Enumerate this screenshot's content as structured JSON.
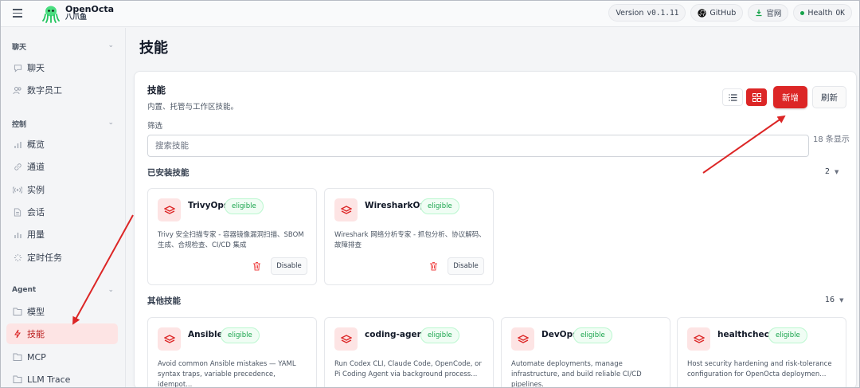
{
  "topbar": {
    "brand_name": "OpenOcta",
    "brand_sub": "八爪鱼",
    "version_label": "Version",
    "version_value": "v0.1.11",
    "github_label": "GitHub",
    "website_label": "官网",
    "health_label": "Health",
    "health_value": "OK"
  },
  "sidebar": {
    "sections": [
      {
        "title": "聊天",
        "items": [
          "聊天",
          "数字员工"
        ]
      },
      {
        "title": "控制",
        "items": [
          "概览",
          "通道",
          "实例",
          "会话",
          "用量",
          "定时任务"
        ]
      },
      {
        "title": "Agent",
        "items": [
          "模型",
          "技能",
          "MCP",
          "LLM Trace"
        ]
      }
    ]
  },
  "page": {
    "title": "技能"
  },
  "card": {
    "title": "技能",
    "subtitle": "内置、托管与工作区技能。",
    "filter_label": "筛选",
    "search_placeholder": "搜索技能",
    "count_text": "18 条显示",
    "add_label": "新增",
    "refresh_label": "刷新"
  },
  "installed": {
    "title": "已安装技能",
    "count": "2",
    "skills": [
      {
        "name": "TrivyOps",
        "badge": "eligible",
        "desc": "Trivy 安全扫描专家 - 容器镜像漏洞扫描、SBOM 生成、合规检查、CI/CD 集成",
        "disable_label": "Disable"
      },
      {
        "name": "WiresharkOps",
        "badge": "eligible",
        "desc": "Wireshark 网络分析专家 - 抓包分析、协议解码、故障排查",
        "disable_label": "Disable"
      }
    ]
  },
  "others": {
    "title": "其他技能",
    "count": "16",
    "skills": [
      {
        "name": "Ansible",
        "badge": "eligible",
        "desc": "Avoid common Ansible mistakes — YAML syntax traps, variable precedence, idempot..."
      },
      {
        "name": "coding-agent",
        "badge": "eligible",
        "desc": "Run Codex CLI, Claude Code, OpenCode, or Pi Coding Agent via background process..."
      },
      {
        "name": "DevOps",
        "badge": "eligible",
        "desc": "Automate deployments, manage infrastructure, and build reliable CI/CD pipelines."
      },
      {
        "name": "healthcheck",
        "badge": "eligible",
        "desc": "Host security hardening and risk-tolerance configuration for OpenOcta deploymen..."
      }
    ]
  },
  "colors": {
    "accent": "#dc2626",
    "badge_green": "#16a34a",
    "active_bg": "#fde4e4"
  }
}
